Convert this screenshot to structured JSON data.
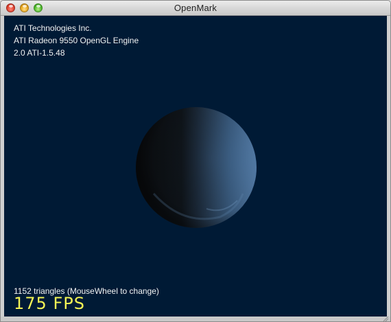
{
  "window": {
    "title": "OpenMark"
  },
  "gl_info": {
    "vendor": "ATI Technologies Inc.",
    "renderer": "ATI Radeon 9550 OpenGL Engine",
    "version": "2.0 ATI-1.5.48"
  },
  "stats": {
    "triangles_text": "1152 triangles (MouseWheel to change)",
    "fps_text": "175 FPS"
  },
  "colors": {
    "viewport_background": "#001a35",
    "info_text": "#f2f2f2",
    "fps_text": "#f4f455",
    "sphere_light": "#5c88b8",
    "sphere_dark": "#0c1014"
  },
  "icons": {
    "close": "close-button-icon",
    "minimize": "minimize-button-icon",
    "maximize": "zoom-button-icon"
  }
}
